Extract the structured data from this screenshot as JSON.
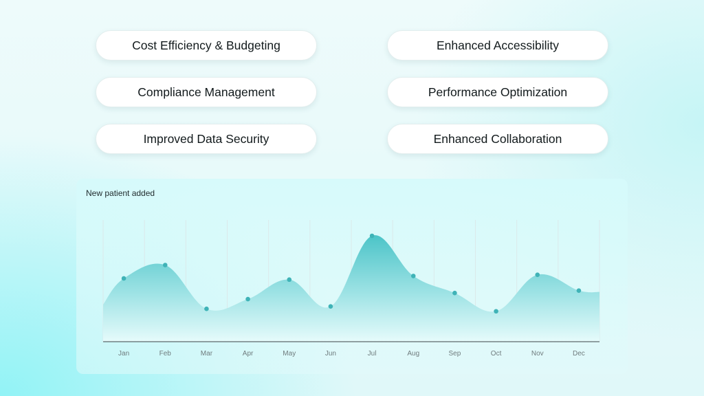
{
  "features": [
    {
      "label": "Cost Efficiency & Budgeting"
    },
    {
      "label": "Enhanced Accessibility"
    },
    {
      "label": "Compliance Management"
    },
    {
      "label": "Performance Optimization"
    },
    {
      "label": "Improved Data Security"
    },
    {
      "label": "Enhanced Collaboration"
    }
  ],
  "colors": {
    "area_top": "#4cc4c8",
    "area_bottom": "#e6fbfb",
    "marker": "#3fb3b7",
    "axis": "#3b4446",
    "gridline": "#dbe9ea"
  },
  "chart_data": {
    "type": "area",
    "title": "New patient added",
    "categories": [
      "Jan",
      "Feb",
      "Mar",
      "Apr",
      "May",
      "Jun",
      "Jul",
      "Aug",
      "Sep",
      "Oct",
      "Nov",
      "Dec"
    ],
    "values": [
      52,
      63,
      27,
      35,
      51,
      29,
      87,
      54,
      40,
      25,
      55,
      42
    ],
    "ylim": [
      0,
      100
    ],
    "grid": "vertical",
    "legend": "none",
    "xlabel": "",
    "ylabel": ""
  }
}
